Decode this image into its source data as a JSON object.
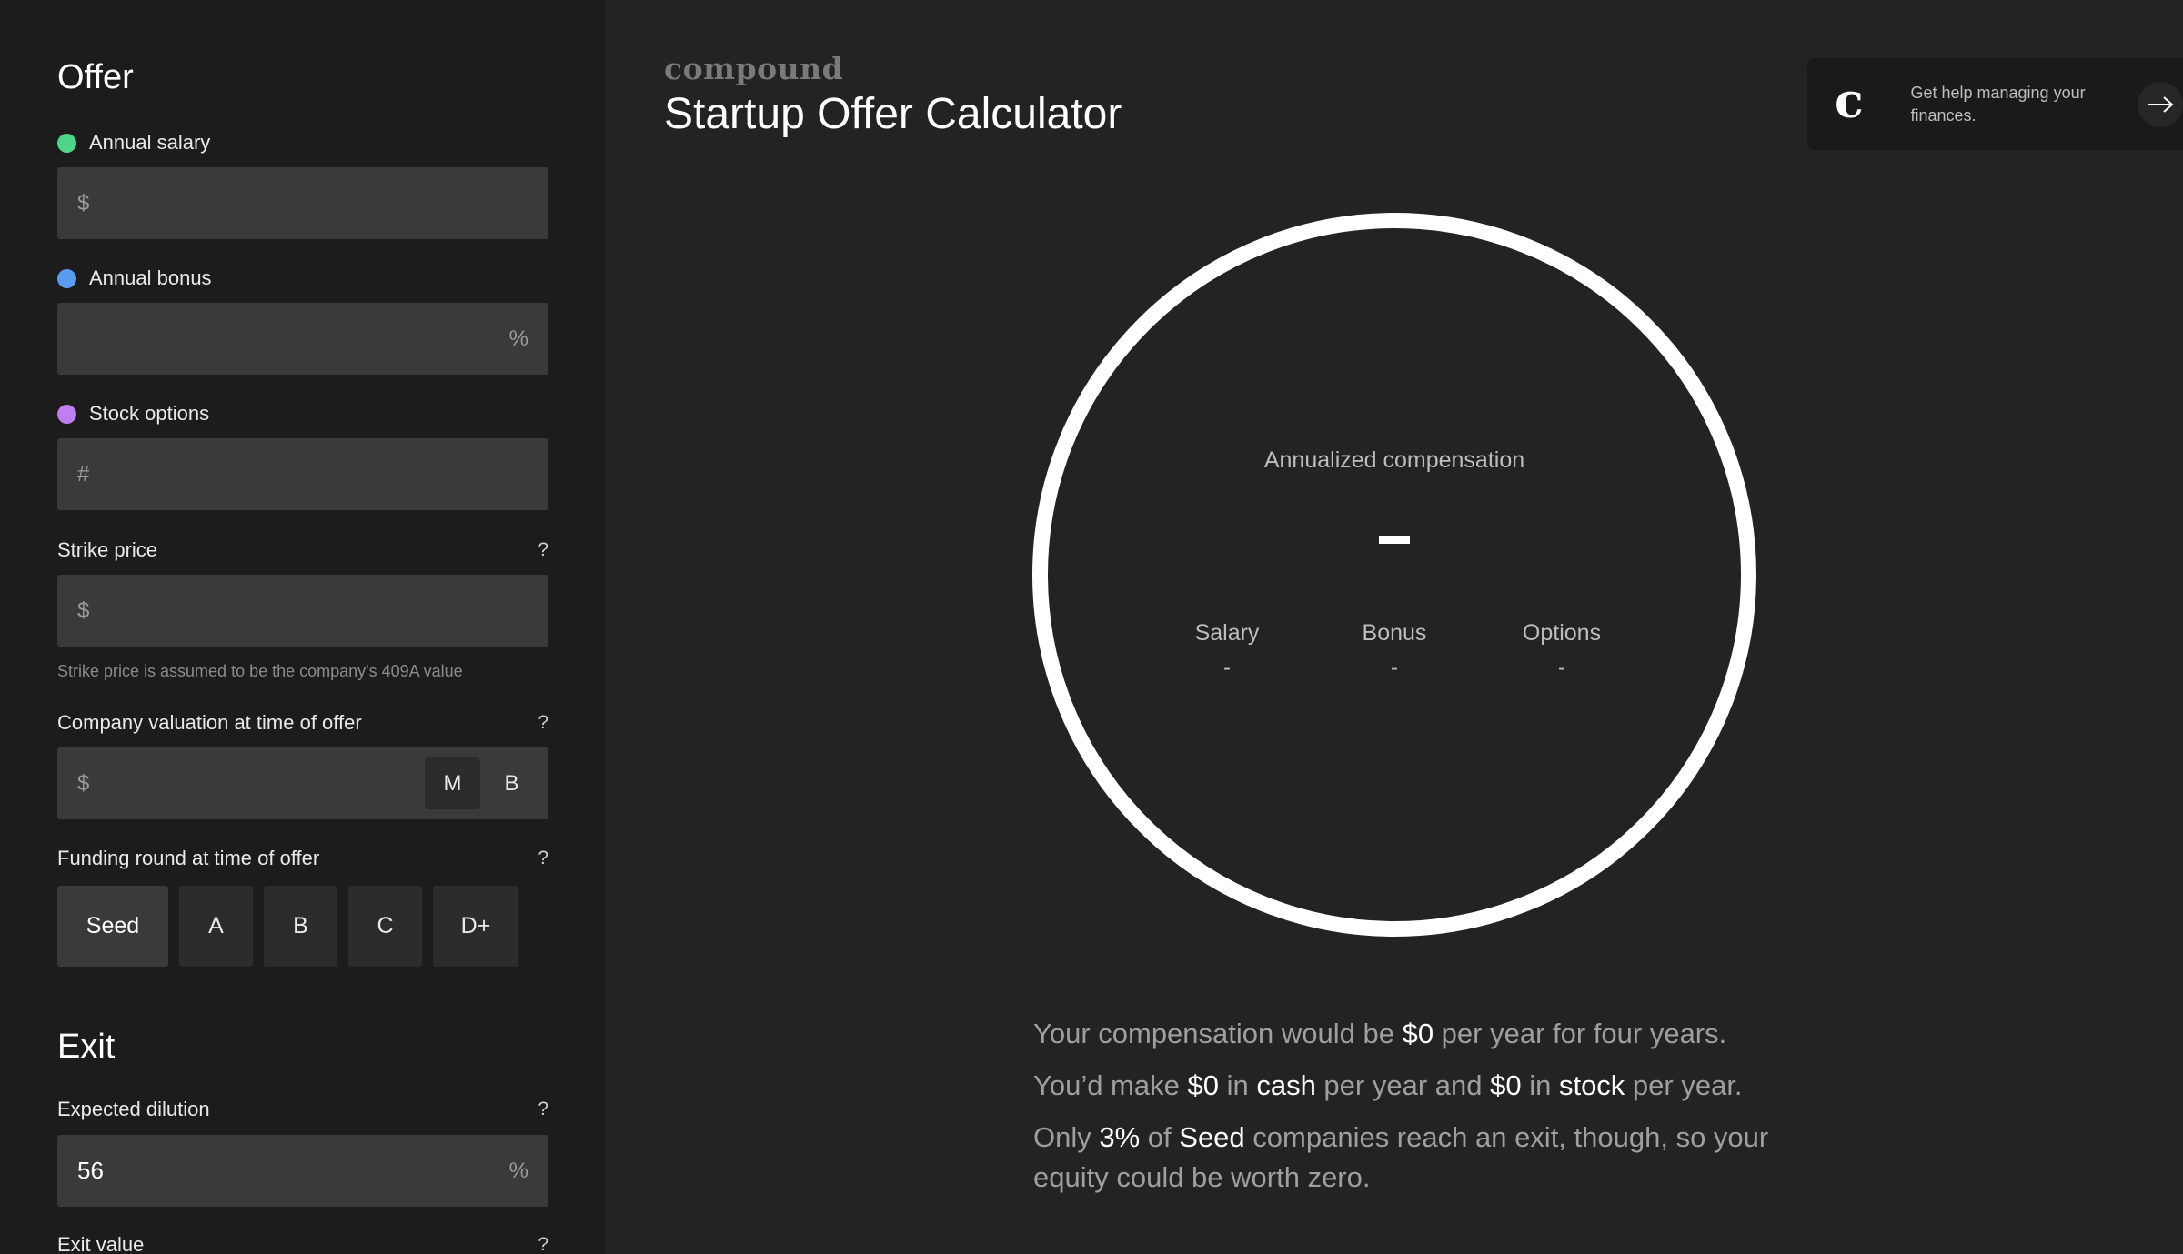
{
  "offer": {
    "title": "Offer",
    "salary": {
      "label": "Annual salary",
      "prefix": "$",
      "dot_color": "#4cd68a"
    },
    "bonus": {
      "label": "Annual bonus",
      "suffix": "%",
      "dot_color": "#5a9cf0"
    },
    "options": {
      "label": "Stock options",
      "prefix": "#",
      "dot_color": "#c07ef0"
    },
    "strike": {
      "label": "Strike price",
      "help": "?",
      "prefix": "$",
      "hint": "Strike price is assumed to be the company's 409A value"
    },
    "valuation": {
      "label": "Company valuation at time of offer",
      "help": "?",
      "prefix": "$",
      "units": [
        "M",
        "B"
      ],
      "selected_unit": "M"
    },
    "funding": {
      "label": "Funding round at time of offer",
      "help": "?",
      "rounds": [
        "Seed",
        "A",
        "B",
        "C",
        "D+"
      ],
      "selected": "Seed"
    }
  },
  "exit": {
    "title": "Exit",
    "dilution": {
      "label": "Expected dilution",
      "help": "?",
      "value": "56",
      "suffix": "%"
    },
    "exit_value": {
      "label": "Exit value",
      "help": "?"
    }
  },
  "header": {
    "brand": "compound",
    "title": "Startup Offer Calculator"
  },
  "help_card": {
    "logo": "c",
    "text": "Get help managing your finances."
  },
  "result": {
    "label": "Annualized compensation",
    "salary": {
      "label": "Salary",
      "value": "-"
    },
    "bonus": {
      "label": "Bonus",
      "value": "-"
    },
    "options": {
      "label": "Options",
      "value": "-"
    }
  },
  "summary": {
    "line1": {
      "a": "Your compensation would be ",
      "b": "$0",
      "c": " per year for four years."
    },
    "line2": {
      "a": "You’d make ",
      "b": "$0",
      "c": " in ",
      "d": "cash",
      "e": " per year and ",
      "f": "$0",
      "g": " in ",
      "h": "stock",
      "i": " per year."
    },
    "line3": {
      "a": "Only ",
      "b": "3%",
      "c": " of ",
      "d": "Seed",
      "e": " companies reach an exit, though, so your equity could be worth zero."
    }
  }
}
